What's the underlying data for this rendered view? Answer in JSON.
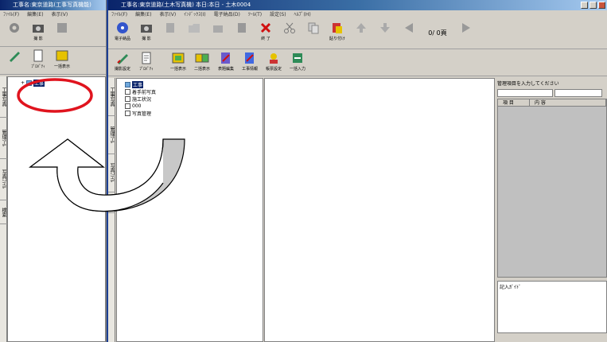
{
  "left_window": {
    "title": "工事名:東京道路(工事写真機能)",
    "menu": [
      "ﾌｧｲﾙ(F)",
      "編集(E)",
      "表示(V)"
    ],
    "toolbar1": [
      {
        "label": "",
        "icon": "gear-icon"
      },
      {
        "label": "撮 影",
        "icon": "camera-icon"
      },
      {
        "label": "",
        "icon": "stack-icon"
      }
    ],
    "toolbar2": [
      {
        "label": "",
        "icon": "pen-icon"
      },
      {
        "label": "ﾌﾟﾛﾊﾟﾃｨ",
        "icon": "document-icon"
      },
      {
        "label": "一括表示",
        "icon": "photo-icon"
      }
    ],
    "vtabs": [
      "工事写真",
      "管理ﾂｰﾙ",
      "写真ﾌｧｲﾙ",
      "検索"
    ],
    "tree": {
      "root_label": "工事"
    }
  },
  "right_window": {
    "title": "工事名:東京道路(土木写真機)  本日:本日  - 土木0004",
    "menu": [
      "ﾌｧｲﾙ(F)",
      "編集(E)",
      "表示(V)",
      "ｲﾝﾃﾞｯｸｽ(I)",
      "電子納品(D)",
      "ﾂｰﾙ(T)",
      "設定(S)",
      "ﾍﾙﾌﾟ(H)"
    ],
    "toolbar1": [
      {
        "label": "電子納品",
        "icon": "disc-icon"
      },
      {
        "label": "撮 影",
        "icon": "camera-icon"
      },
      {
        "label": "",
        "icon": "book-icon"
      },
      {
        "label": "",
        "icon": "folder-icon"
      },
      {
        "label": "",
        "icon": "grid-icon"
      },
      {
        "label": "",
        "icon": "stack-icon"
      },
      {
        "label": "終 了",
        "icon": "close-icon"
      },
      {
        "label": "",
        "icon": "scissors-icon"
      },
      {
        "label": "",
        "icon": "copy-icon"
      },
      {
        "label": "貼り付け",
        "icon": "paste-icon"
      },
      {
        "label": "",
        "icon": "arrow-up-icon"
      },
      {
        "label": "",
        "icon": "arrow-down-icon"
      },
      {
        "label": "",
        "icon": "arrow-left-icon"
      },
      {
        "label": "",
        "icon": "arrow-right-icon"
      }
    ],
    "page_indicator": "0/ 0頁",
    "toolbar2": [
      {
        "label": "撮影設定",
        "icon": "pen-icon"
      },
      {
        "label": "ﾌﾟﾛﾊﾟﾃｨ",
        "icon": "document-icon"
      },
      {
        "label": "一括表示",
        "icon": "photo-icon"
      },
      {
        "label": "二括表示",
        "icon": "photos-icon"
      },
      {
        "label": "表題編集",
        "icon": "edit-icon"
      },
      {
        "label": "工事情報",
        "icon": "info-icon"
      },
      {
        "label": "帳票設定",
        "icon": "report-icon"
      },
      {
        "label": "一括入力",
        "icon": "batch-icon"
      }
    ],
    "vtabs": [
      "工事写真",
      "管理ﾂｰﾙ",
      "写真ﾌｧｲﾙ",
      "検索"
    ],
    "tree": {
      "root_label": "工事",
      "children": [
        "着手前写真",
        "施工状況",
        "000",
        "写真管理"
      ]
    },
    "side_panel": {
      "search_prompt": "管理項目を入力してください",
      "col1": "項 目",
      "col2": "内 容",
      "footer": "記入ｶﾞｲﾄﾞ"
    }
  },
  "colors": {
    "titlebar": "#0a246a",
    "selection": "#0a246a",
    "highlight_circle": "#e0141e",
    "arrow_fill": "#c8c8c8"
  }
}
